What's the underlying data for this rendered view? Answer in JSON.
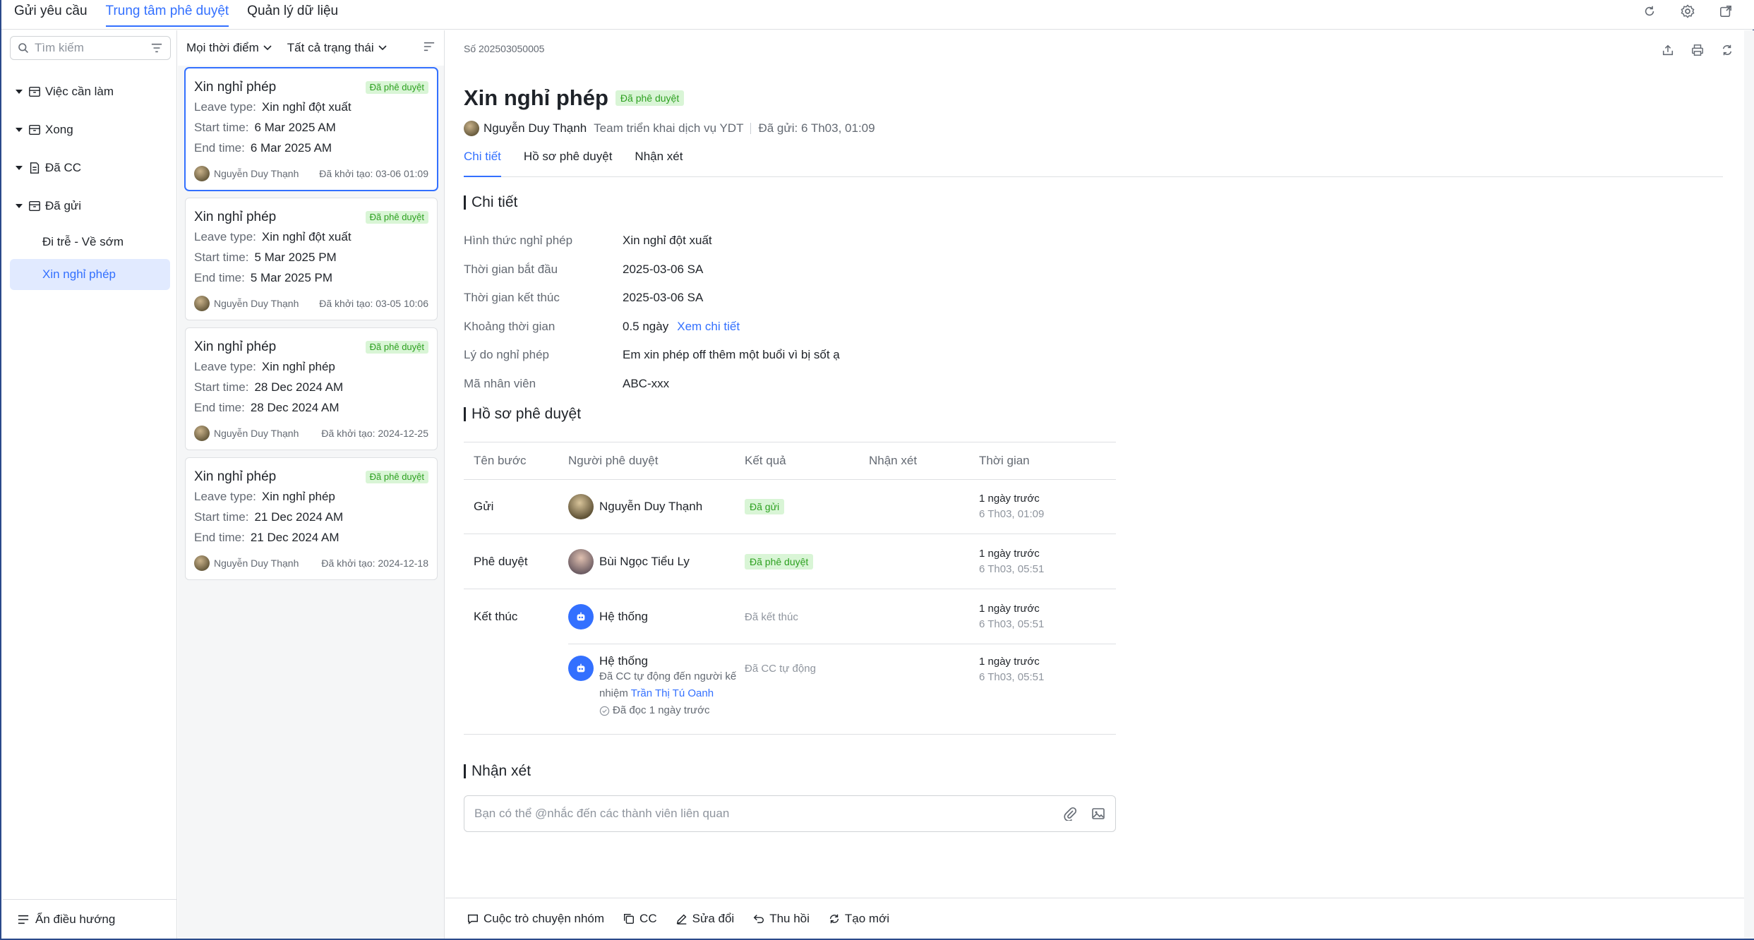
{
  "topnav": {
    "tabs": [
      {
        "label": "Gửi yêu cầu"
      },
      {
        "label": "Trung tâm phê duyệt"
      },
      {
        "label": "Quản lý dữ liệu"
      }
    ]
  },
  "sidebar": {
    "search_placeholder": "Tìm kiếm",
    "groups": [
      {
        "label": "Việc cần làm"
      },
      {
        "label": "Xong"
      },
      {
        "label": "Đã CC"
      },
      {
        "label": "Đã gửi"
      }
    ],
    "subitems": [
      {
        "label": "Đi trễ - Về sớm"
      },
      {
        "label": "Xin nghỉ phép"
      }
    ],
    "hide_nav_label": "Ẩn điều hướng"
  },
  "list": {
    "filter_time": "Mọi thời điểm",
    "filter_status": "Tất cả trạng thái",
    "field_labels": {
      "leave_type": "Leave type:",
      "start": "Start time:",
      "end": "End time:"
    },
    "cards": [
      {
        "title": "Xin nghỉ phép",
        "badge": "Đã phê duyệt",
        "leave_type": "Xin nghỉ đột xuất",
        "start": "6 Mar 2025 AM",
        "end": "6 Mar 2025 AM",
        "user": "Nguyễn Duy Thạnh",
        "created": "Đã khởi tạo: 03-06 01:09"
      },
      {
        "title": "Xin nghỉ phép",
        "badge": "Đã phê duyệt",
        "leave_type": "Xin nghỉ đột xuất",
        "start": "5 Mar 2025 PM",
        "end": "5 Mar 2025 PM",
        "user": "Nguyễn Duy Thạnh",
        "created": "Đã khởi tạo: 03-05 10:06"
      },
      {
        "title": "Xin nghỉ phép",
        "badge": "Đã phê duyệt",
        "leave_type": "Xin nghỉ phép",
        "start": "28 Dec 2024 AM",
        "end": "28 Dec 2024 AM",
        "user": "Nguyễn Duy Thạnh",
        "created": "Đã khởi tạo: 2024-12-25"
      },
      {
        "title": "Xin nghỉ phép",
        "badge": "Đã phê duyệt",
        "leave_type": "Xin nghỉ phép",
        "start": "21 Dec 2024 AM",
        "end": "21 Dec 2024 AM",
        "user": "Nguyễn Duy Thạnh",
        "created": "Đã khởi tạo: 2024-12-18"
      }
    ]
  },
  "detail": {
    "number": "Số 202503050005",
    "title": "Xin nghỉ phép",
    "status_badge": "Đã phê duyệt",
    "requester": "Nguyễn Duy Thạnh",
    "team": "Team triển khai dịch vụ YDT",
    "sent": "Đã gửi:  6 Th03, 01:09",
    "tabs": [
      {
        "label": "Chi tiết"
      },
      {
        "label": "Hồ sơ phê duyệt"
      },
      {
        "label": "Nhận xét"
      }
    ],
    "section_details": "Chi tiết",
    "fields": [
      {
        "label": "Hình thức nghỉ phép",
        "value": "Xin nghỉ đột xuất"
      },
      {
        "label": "Thời gian bắt đầu",
        "value": "2025-03-06 SA"
      },
      {
        "label": "Thời gian kết thúc",
        "value": "2025-03-06 SA"
      },
      {
        "label": "Khoảng thời gian",
        "value": "0.5 ngày",
        "link": "Xem chi tiết"
      },
      {
        "label": "Lý do nghỉ phép",
        "value": "Em xin phép off thêm một buổi vì bị sốt ạ"
      },
      {
        "label": "Mã nhân viên",
        "value": "ABC-xxx"
      }
    ],
    "section_record": "Hồ sơ phê duyệt",
    "table": {
      "headers": [
        "Tên bước",
        "Người phê duyệt",
        "Kết quả",
        "Nhận xét",
        "Thời gian"
      ],
      "rows": [
        {
          "step": "Gửi",
          "person": "Nguyễn Duy Thạnh",
          "result": "Đã gửi",
          "time1": "1 ngày trước",
          "time2": "6 Th03, 01:09"
        },
        {
          "step": "Phê duyệt",
          "person": "Bùi Ngọc Tiểu Ly",
          "result": "Đã phê duyệt",
          "time1": "1 ngày trước",
          "time2": "6 Th03, 05:51"
        },
        {
          "step": "Kết thúc",
          "person": "Hệ thống",
          "result": "Đã kết thúc",
          "time1": "1 ngày trước",
          "time2": "6 Th03, 05:51"
        },
        {
          "step": "",
          "person": "Hệ thống",
          "desc1": "Đã CC tự động đến người kế",
          "desc2": "nhiệm",
          "desc_link": "Trần Thị Tú Oanh",
          "read": "Đã đọc 1 ngày trước",
          "result": "Đã CC tự động",
          "time1": "1 ngày trước",
          "time2": "6 Th03, 05:51"
        }
      ]
    },
    "section_comments": "Nhận xét",
    "comment_placeholder": "Bạn có thể @nhắc đến các thành viên liên quan",
    "footer": [
      {
        "label": "Cuộc trò chuyện nhóm"
      },
      {
        "label": "CC"
      },
      {
        "label": "Sửa đổi"
      },
      {
        "label": "Thu hồi"
      },
      {
        "label": "Tạo mới"
      }
    ]
  },
  "colors": {
    "accent": "#3370ff",
    "success_bg": "#d9f5d6",
    "success_text": "#2ea121"
  }
}
